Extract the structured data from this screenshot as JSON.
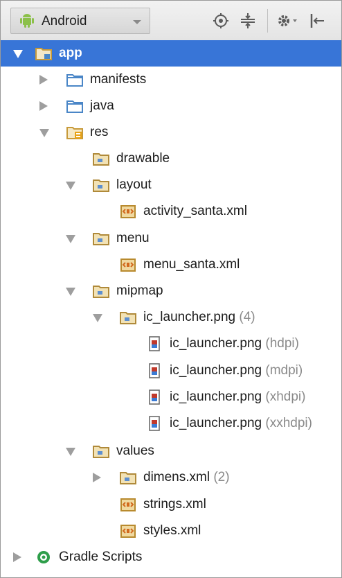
{
  "toolbar": {
    "view_mode": "Android",
    "icons": [
      "scroll-from-source-icon",
      "collapse-all-icon",
      "settings-icon",
      "hide-icon"
    ]
  },
  "tree": [
    {
      "id": "app",
      "label": "app",
      "extra": "",
      "expanded": true,
      "icon": "module-folder-icon",
      "selected": true
    },
    {
      "id": "manifests",
      "label": "manifests",
      "extra": "",
      "expanded": false,
      "icon": "folder-icon"
    },
    {
      "id": "java",
      "label": "java",
      "extra": "",
      "expanded": false,
      "icon": "folder-icon"
    },
    {
      "id": "res",
      "label": "res",
      "extra": "",
      "expanded": true,
      "icon": "resource-folder-icon"
    },
    {
      "id": "drawable",
      "label": "drawable",
      "extra": "",
      "icon": "resource-dir-icon"
    },
    {
      "id": "layout",
      "label": "layout",
      "extra": "",
      "expanded": true,
      "icon": "resource-dir-icon"
    },
    {
      "id": "activity_santa",
      "label": "activity_santa.xml",
      "extra": "",
      "icon": "xml-file-icon"
    },
    {
      "id": "menu",
      "label": "menu",
      "extra": "",
      "expanded": true,
      "icon": "resource-dir-icon"
    },
    {
      "id": "menu_santa",
      "label": "menu_santa.xml",
      "extra": "",
      "icon": "xml-file-icon"
    },
    {
      "id": "mipmap",
      "label": "mipmap",
      "extra": "",
      "expanded": true,
      "icon": "resource-dir-icon"
    },
    {
      "id": "ic_launcher_group",
      "label": "ic_launcher.png",
      "extra": "(4)",
      "expanded": true,
      "icon": "resource-dir-icon"
    },
    {
      "id": "ic_hdpi",
      "label": "ic_launcher.png",
      "extra": "(hdpi)",
      "icon": "image-file-icon"
    },
    {
      "id": "ic_mdpi",
      "label": "ic_launcher.png",
      "extra": "(mdpi)",
      "icon": "image-file-icon"
    },
    {
      "id": "ic_xhdpi",
      "label": "ic_launcher.png",
      "extra": "(xhdpi)",
      "icon": "image-file-icon"
    },
    {
      "id": "ic_xxhdpi",
      "label": "ic_launcher.png",
      "extra": "(xxhdpi)",
      "icon": "image-file-icon"
    },
    {
      "id": "values",
      "label": "values",
      "extra": "",
      "expanded": true,
      "icon": "resource-dir-icon"
    },
    {
      "id": "dimens",
      "label": "dimens.xml",
      "extra": "(2)",
      "expanded": false,
      "icon": "resource-dir-icon"
    },
    {
      "id": "strings",
      "label": "strings.xml",
      "extra": "",
      "icon": "xml-file-icon"
    },
    {
      "id": "styles",
      "label": "styles.xml",
      "extra": "",
      "icon": "xml-file-icon"
    },
    {
      "id": "gradle",
      "label": "Gradle Scripts",
      "extra": "",
      "expanded": false,
      "icon": "gradle-icon"
    }
  ]
}
